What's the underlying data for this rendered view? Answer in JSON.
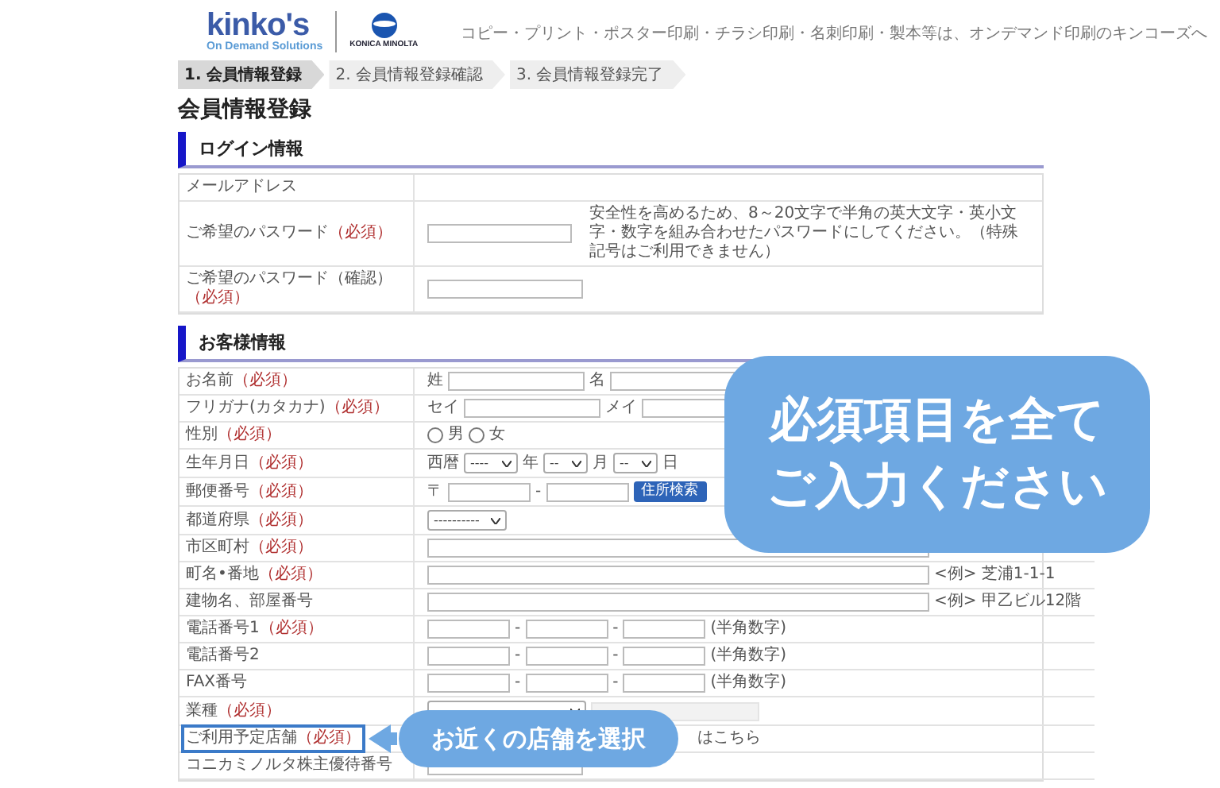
{
  "header": {
    "logo": {
      "brand": "kinko's",
      "subtitle": "On Demand Solutions",
      "partner": "KONICA MINOLTA"
    },
    "tagline": "コピー・プリント・ポスター印刷・チラシ印刷・名刺印刷・製本等は、オンデマンド印刷のキンコーズへ"
  },
  "steps": [
    {
      "label": "1. 会員情報登録",
      "selected": true
    },
    {
      "label": "2. 会員情報登録確認",
      "selected": false
    },
    {
      "label": "3. 会員情報登録完了",
      "selected": false
    }
  ],
  "title": "会員情報登録",
  "sections": [
    {
      "heading": "ログイン情報",
      "rows": [
        {
          "label": "メールアドレス",
          "kind": "empty"
        },
        {
          "label": "ご希望のパスワード",
          "required_mark": "（必須）",
          "kind": "password",
          "note": "安全性を高めるため、8～20文字で半角の英大文字・英小文字・数字を組み合わせたパスワードにしてください。（特殊記号はご利用できません）"
        },
        {
          "label": "ご希望のパスワード（確認）",
          "required_mark": "（必須）",
          "kind": "input"
        }
      ]
    },
    {
      "heading": "お客様情報",
      "rows": [
        {
          "label": "お名前",
          "required_mark": "（必須）",
          "kind": "pair",
          "prefixes": [
            "姓",
            "名"
          ]
        },
        {
          "label": "フリガナ(カタカナ)",
          "required_mark": "（必須）",
          "kind": "pair",
          "prefixes": [
            "セイ",
            "メイ"
          ]
        },
        {
          "label": "性別",
          "required_mark": "（必須）",
          "kind": "radio",
          "options": [
            {
              "label": "男",
              "selected": false
            },
            {
              "label": "女",
              "selected": false
            }
          ]
        },
        {
          "label": "生年月日",
          "required_mark": "（必須）",
          "kind": "date",
          "parts": [
            {
              "prefix": "西暦",
              "value": "----",
              "unit": "年"
            },
            {
              "value": "--",
              "unit": "月"
            },
            {
              "value": "--",
              "unit": "日"
            }
          ]
        },
        {
          "label": "郵便番号",
          "required_mark": "（必須）",
          "kind": "postal",
          "prefix": "〒",
          "separator": "-",
          "button": "住所検索"
        },
        {
          "label": "都道府県",
          "required_mark": "（必須）",
          "kind": "select",
          "value": "----------"
        },
        {
          "label": "市区町村",
          "required_mark": "（必須）",
          "kind": "wide"
        },
        {
          "label": "町名•番地",
          "required_mark": "（必須）",
          "kind": "wide",
          "note": "<例> 芝浦1-1-1"
        },
        {
          "label": "建物名、部屋番号",
          "kind": "wide",
          "note": "<例> 甲乙ビル12階"
        },
        {
          "label": "電話番号1",
          "required_mark": "（必須）",
          "kind": "phone",
          "separators": [
            "-",
            "-"
          ],
          "note": "(半角数字)"
        },
        {
          "label": "電話番号2",
          "kind": "phone",
          "separators": [
            "-",
            "-"
          ],
          "note": "(半角数字)"
        },
        {
          "label": "FAX番号",
          "kind": "phone",
          "separators": [
            "-",
            "-"
          ],
          "note": "(半角数字)"
        },
        {
          "label": "業種",
          "required_mark": "（必須）",
          "kind": "industry"
        },
        {
          "label": "ご利用予定店舗",
          "required_mark": "（必須）",
          "kind": "link",
          "note": "はこちら",
          "highlighted": true
        },
        {
          "label": "コニカミノルタ株主優待番号",
          "kind": "input"
        }
      ]
    }
  ],
  "callouts": [
    {
      "kind": "panel",
      "lines": [
        "必須項目を全て",
        "ご入力ください"
      ]
    },
    {
      "kind": "bubble",
      "lines": [
        "お近くの店舗を選択"
      ]
    }
  ]
}
